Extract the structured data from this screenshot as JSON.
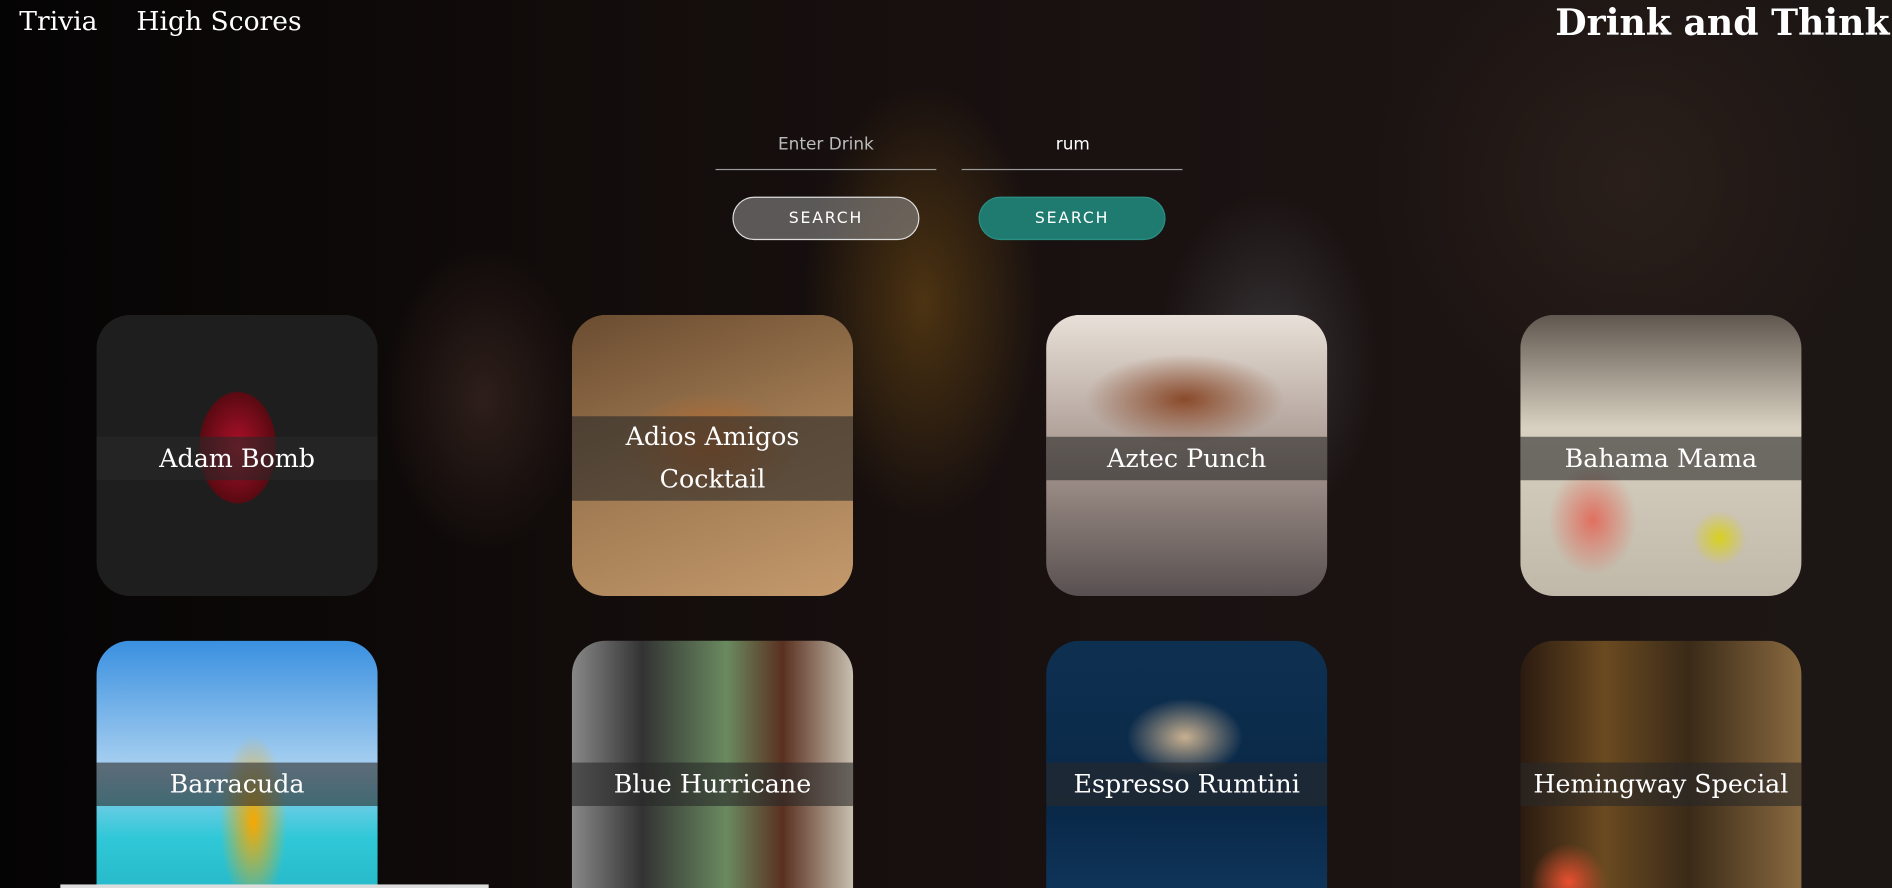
{
  "nav": {
    "trivia": "Trivia",
    "high_scores": "High Scores"
  },
  "app_title": "Drink and Think",
  "search": {
    "drink_placeholder": "Enter Drink",
    "drink_value": "",
    "ingredient_value": "rum",
    "search_drink_label": "SEARCH",
    "search_ingredient_label": "SEARCH"
  },
  "colors": {
    "accent": "#1f7b70"
  },
  "drinks": [
    {
      "name": "Adam Bomb"
    },
    {
      "name": "Adios Amigos Cocktail"
    },
    {
      "name": "Aztec Punch"
    },
    {
      "name": "Bahama Mama"
    },
    {
      "name": "Barracuda"
    },
    {
      "name": "Blue Hurricane"
    },
    {
      "name": "Espresso Rumtini"
    },
    {
      "name": "Hemingway Special"
    }
  ]
}
